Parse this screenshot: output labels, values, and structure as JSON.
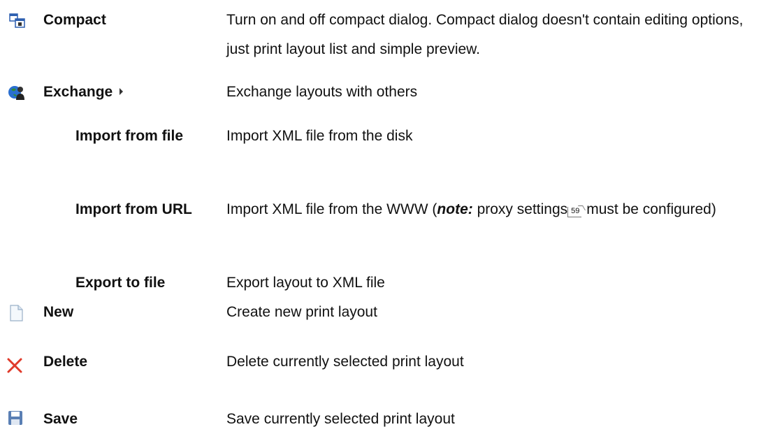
{
  "rows": [
    {
      "label": "Compact",
      "desc_lines": "Turn on and off compact dialog. Compact dialog doesn't contain editing options, just print layout list and simple preview.",
      "icon": "compact-window-icon"
    },
    {
      "label": "Exchange",
      "desc_lines": "Exchange layouts with others",
      "icon": "globe-user-icon",
      "has_submenu": true
    },
    {
      "label": "Import from file",
      "desc_lines": "Import XML file from the disk"
    },
    {
      "label": "Import from URL",
      "desc_pre": "Import XML file from the WWW (",
      "desc_note": "note:",
      "desc_mid": " proxy settings",
      "desc_ref": "59",
      "desc_post": " must be configured)"
    },
    {
      "label": "Export to file",
      "desc_lines": "Export layout to XML file"
    },
    {
      "label": "New",
      "desc_lines": "Create new print layout",
      "icon": "new-document-icon"
    },
    {
      "label": "Delete",
      "desc_lines": "Delete currently selected print layout",
      "icon": "delete-x-icon"
    },
    {
      "label": "Save",
      "desc_lines": "Save currently selected print layout",
      "icon": "save-disk-icon"
    }
  ],
  "colors": {
    "delete_red": "#e03a2a",
    "compact_blue": "#2d5fb0",
    "save_blue": "#5a7fb4"
  }
}
